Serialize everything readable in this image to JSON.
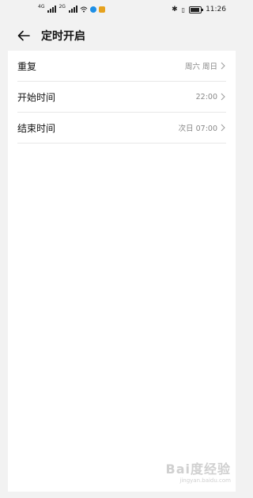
{
  "status_bar": {
    "network_1": "4G",
    "network_2": "2G",
    "time": "11:26"
  },
  "header": {
    "title": "定时开启"
  },
  "settings": [
    {
      "label": "重复",
      "value": "周六 周日"
    },
    {
      "label": "开始时间",
      "value": "22:00"
    },
    {
      "label": "结束时间",
      "value": "次日 07:00"
    }
  ],
  "icons": {
    "back": "back-arrow-icon",
    "chevron": "chevron-right-icon"
  },
  "watermark": {
    "brand": "Bai度经验",
    "url": "jingyan.baidu.com"
  }
}
